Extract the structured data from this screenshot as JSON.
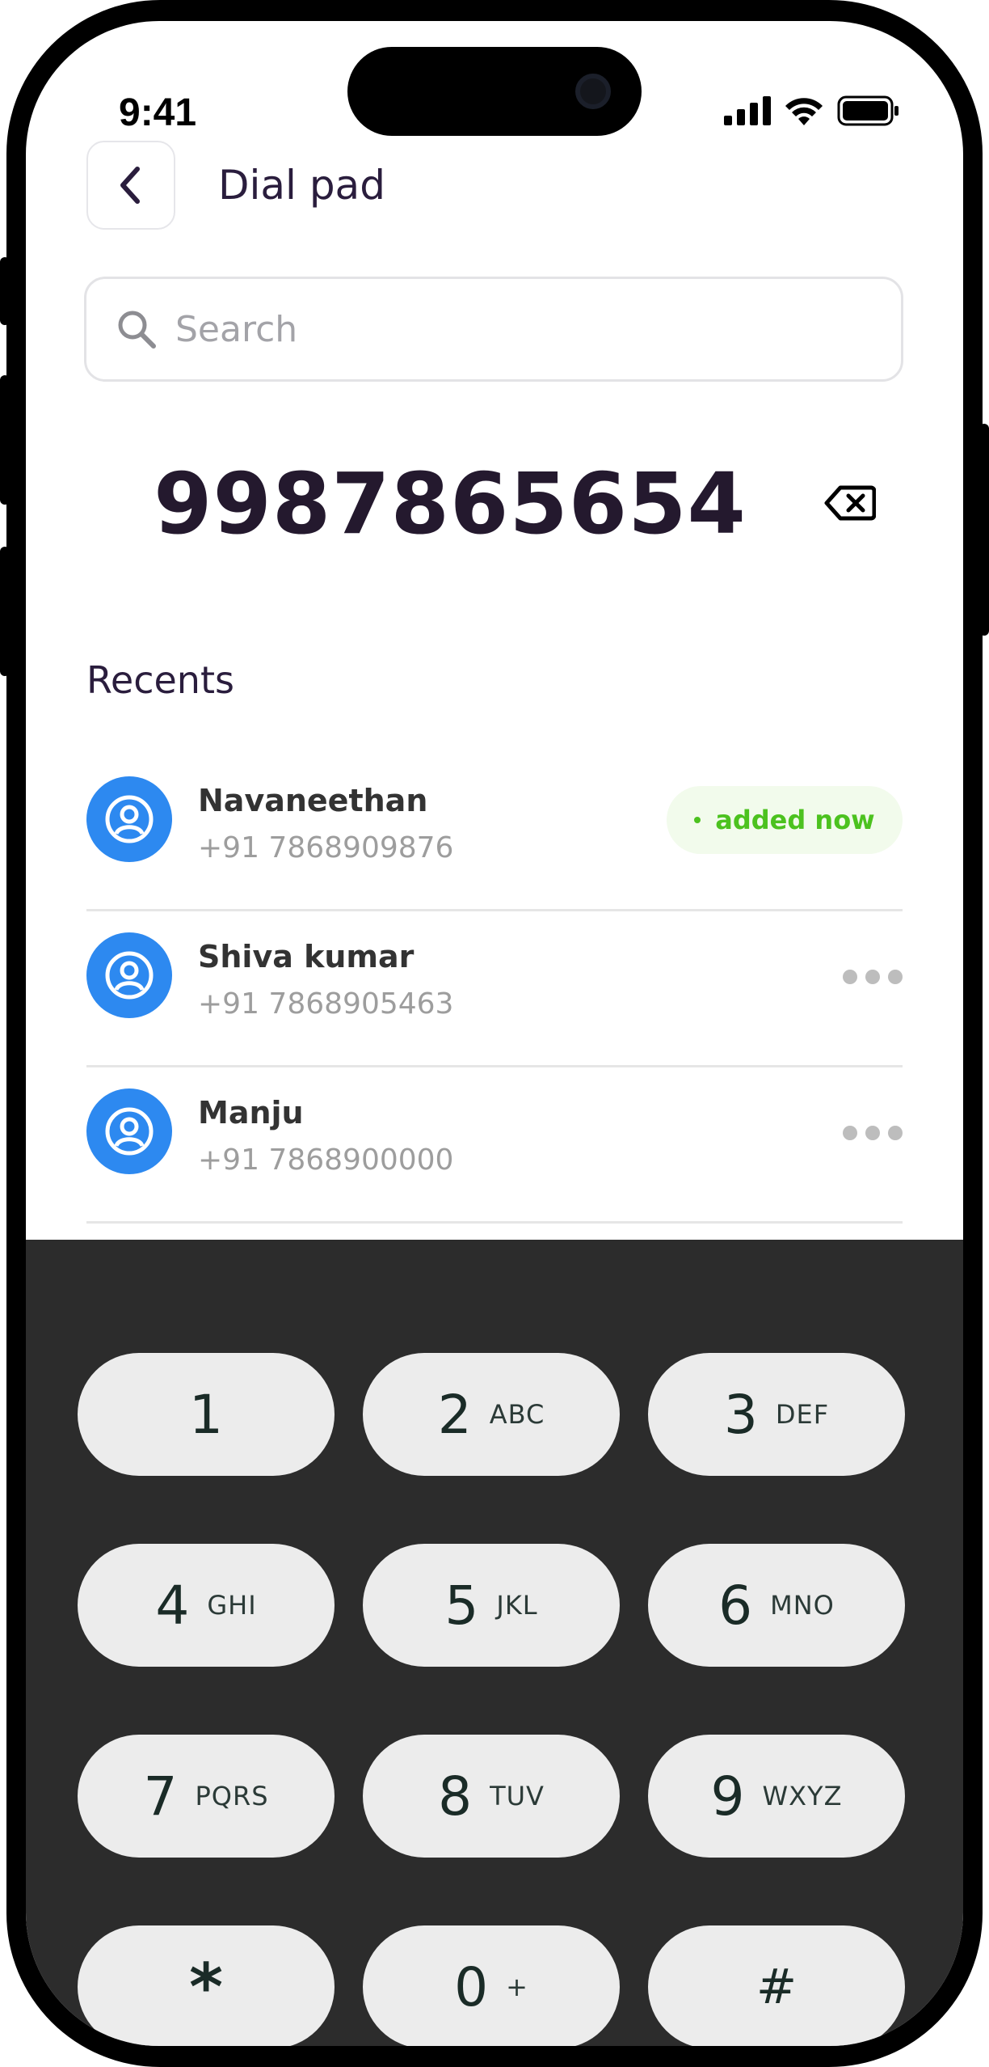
{
  "status": {
    "time": "9:41"
  },
  "header": {
    "title": "Dial pad"
  },
  "search": {
    "placeholder": "Search"
  },
  "dialer": {
    "number": "9987865654"
  },
  "recents": {
    "title": "Recents",
    "items": [
      {
        "name": "Navaneethan",
        "phone": "+91 7868909876",
        "badge": "added now"
      },
      {
        "name": "Shiva kumar",
        "phone": "+91 7868905463"
      },
      {
        "name": "Manju",
        "phone": "+91 7868900000"
      }
    ]
  },
  "keypad": {
    "keys": [
      {
        "digit": "1",
        "letters": ""
      },
      {
        "digit": "2",
        "letters": "ABC"
      },
      {
        "digit": "3",
        "letters": "DEF"
      },
      {
        "digit": "4",
        "letters": "GHI"
      },
      {
        "digit": "5",
        "letters": "JKL"
      },
      {
        "digit": "6",
        "letters": "MNO"
      },
      {
        "digit": "7",
        "letters": "PQRS"
      },
      {
        "digit": "8",
        "letters": "TUV"
      },
      {
        "digit": "9",
        "letters": "WXYZ"
      },
      {
        "digit": "*",
        "letters": ""
      },
      {
        "digit": "0",
        "letters": "+"
      },
      {
        "digit": "#",
        "letters": ""
      }
    ]
  },
  "colors": {
    "accent": "#2d89f0",
    "badge_green": "#4cc21f",
    "keypad_bg": "#2c2c2c",
    "key_bg": "#ececec"
  }
}
